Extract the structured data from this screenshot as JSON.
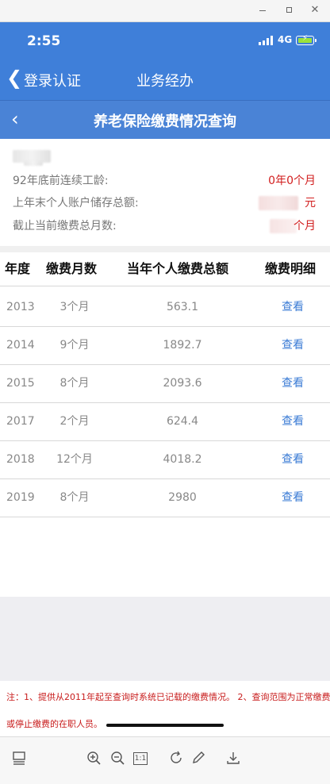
{
  "status_bar": {
    "time": "2:55",
    "network": "4G"
  },
  "nav": {
    "back_label": "登录认证",
    "title": "业务经办"
  },
  "page": {
    "title": "养老保险缴费情况查询"
  },
  "info": {
    "rows": [
      {
        "label": "92年底前连续工龄:",
        "value": "0年0个月"
      },
      {
        "label": "上年末个人账户储存总额:",
        "value": "元"
      },
      {
        "label": "截止当前缴费总月数:",
        "value": "个月"
      }
    ]
  },
  "table": {
    "headers": [
      "年度",
      "缴费月数",
      "当年个人缴费总额",
      "缴费明细"
    ],
    "rows": [
      {
        "year": "2013",
        "months": "3个月",
        "amount": "563.1",
        "link": "查看"
      },
      {
        "year": "2014",
        "months": "9个月",
        "amount": "1892.7",
        "link": "查看"
      },
      {
        "year": "2015",
        "months": "8个月",
        "amount": "2093.6",
        "link": "查看"
      },
      {
        "year": "2017",
        "months": "2个月",
        "amount": "624.4",
        "link": "查看"
      },
      {
        "year": "2018",
        "months": "12个月",
        "amount": "4018.2",
        "link": "查看"
      },
      {
        "year": "2019",
        "months": "8个月",
        "amount": "2980",
        "link": "查看"
      }
    ]
  },
  "note": {
    "line1": "注：1、提供从2011年起至查询时系统已记载的缴费情况。 2、查询范围为正常缴费",
    "line2": "或停止缴费的在职人员。"
  },
  "toolbar": {
    "icons": [
      "layout-icon",
      "zoom-in-icon",
      "zoom-out-icon",
      "actual-size-icon",
      "rotate-icon",
      "edit-icon",
      "download-icon"
    ],
    "actual_size_label": "1:1"
  },
  "colors": {
    "primary_blue": "#3f7fd9",
    "header_blue": "#4a83d6",
    "alert_red": "#d21e1e",
    "link_blue": "#3a7bd5"
  }
}
